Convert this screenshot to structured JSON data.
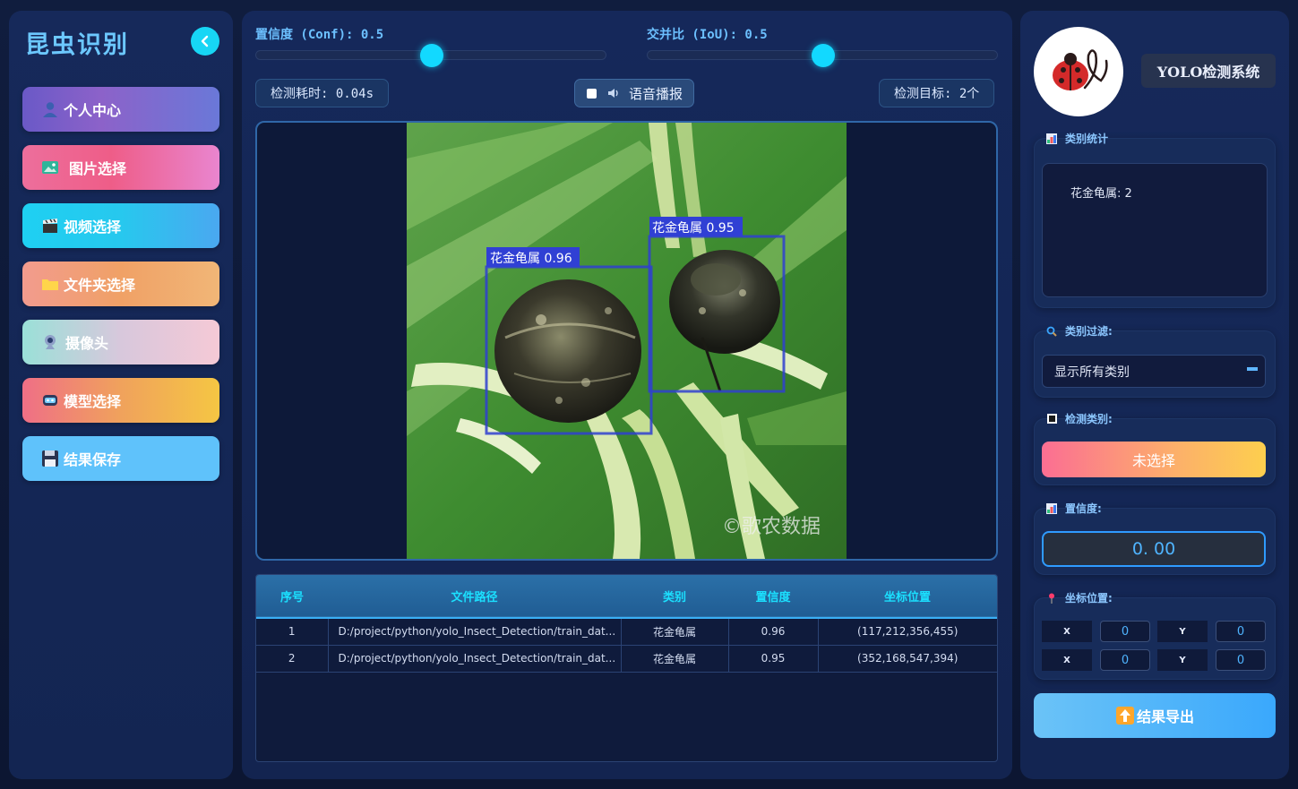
{
  "sidebar": {
    "title": "昆虫识别",
    "items": [
      {
        "label": "个人中心",
        "icon": "user-icon"
      },
      {
        "label": "图片选择",
        "icon": "image-icon"
      },
      {
        "label": "视频选择",
        "icon": "clapper-icon"
      },
      {
        "label": "文件夹选择",
        "icon": "folder-icon"
      },
      {
        "label": "摄像头",
        "icon": "webcam-icon"
      },
      {
        "label": "模型选择",
        "icon": "robot-icon"
      },
      {
        "label": "结果保存",
        "icon": "floppy-icon"
      }
    ]
  },
  "controls": {
    "conf_label": "置信度 (Conf): 0.5",
    "conf_value": 0.5,
    "iou_label": "交并比 (IoU): 0.5",
    "iou_value": 0.5,
    "time_label": "检测耗时: 0.04s",
    "voice_label": "语音播报",
    "target_label": "检测目标: 2个"
  },
  "detections": {
    "box1_label": "花金龟属 0.96",
    "box2_label": "花金龟属 0.95",
    "watermark": "©歌农数据"
  },
  "table": {
    "headers": [
      "序号",
      "文件路径",
      "类别",
      "置信度",
      "坐标位置"
    ],
    "rows": [
      {
        "index": "1",
        "path": "D:/project/python/yolo_Insect_Detection/train_dat...",
        "category": "花金龟属",
        "conf": "0.96",
        "coords": "(117,212,356,455)"
      },
      {
        "index": "2",
        "path": "D:/project/python/yolo_Insect_Detection/train_dat...",
        "category": "花金龟属",
        "conf": "0.95",
        "coords": "(352,168,547,394)"
      }
    ]
  },
  "right": {
    "system_title": "YOLO检测系统",
    "stats_title": "类别统计",
    "stats_text": "花金龟属: 2",
    "filter_title": "类别过滤:",
    "filter_value": "显示所有类别",
    "det_class_title": "检测类别:",
    "det_class_value": "未选择",
    "conf_title": "置信度:",
    "conf_value": "0. 00",
    "coord_title": "坐标位置:",
    "coords": {
      "x1_label": "X",
      "y1_label": "Y",
      "x2_label": "X",
      "y2_label": "Y",
      "x1": "0",
      "y1": "0",
      "x2": "0",
      "y2": "0"
    },
    "export_label": "结果导出"
  },
  "colors": {
    "accent": "#12d9ff",
    "panel": "#15285a",
    "box": "#2f3fd0"
  }
}
